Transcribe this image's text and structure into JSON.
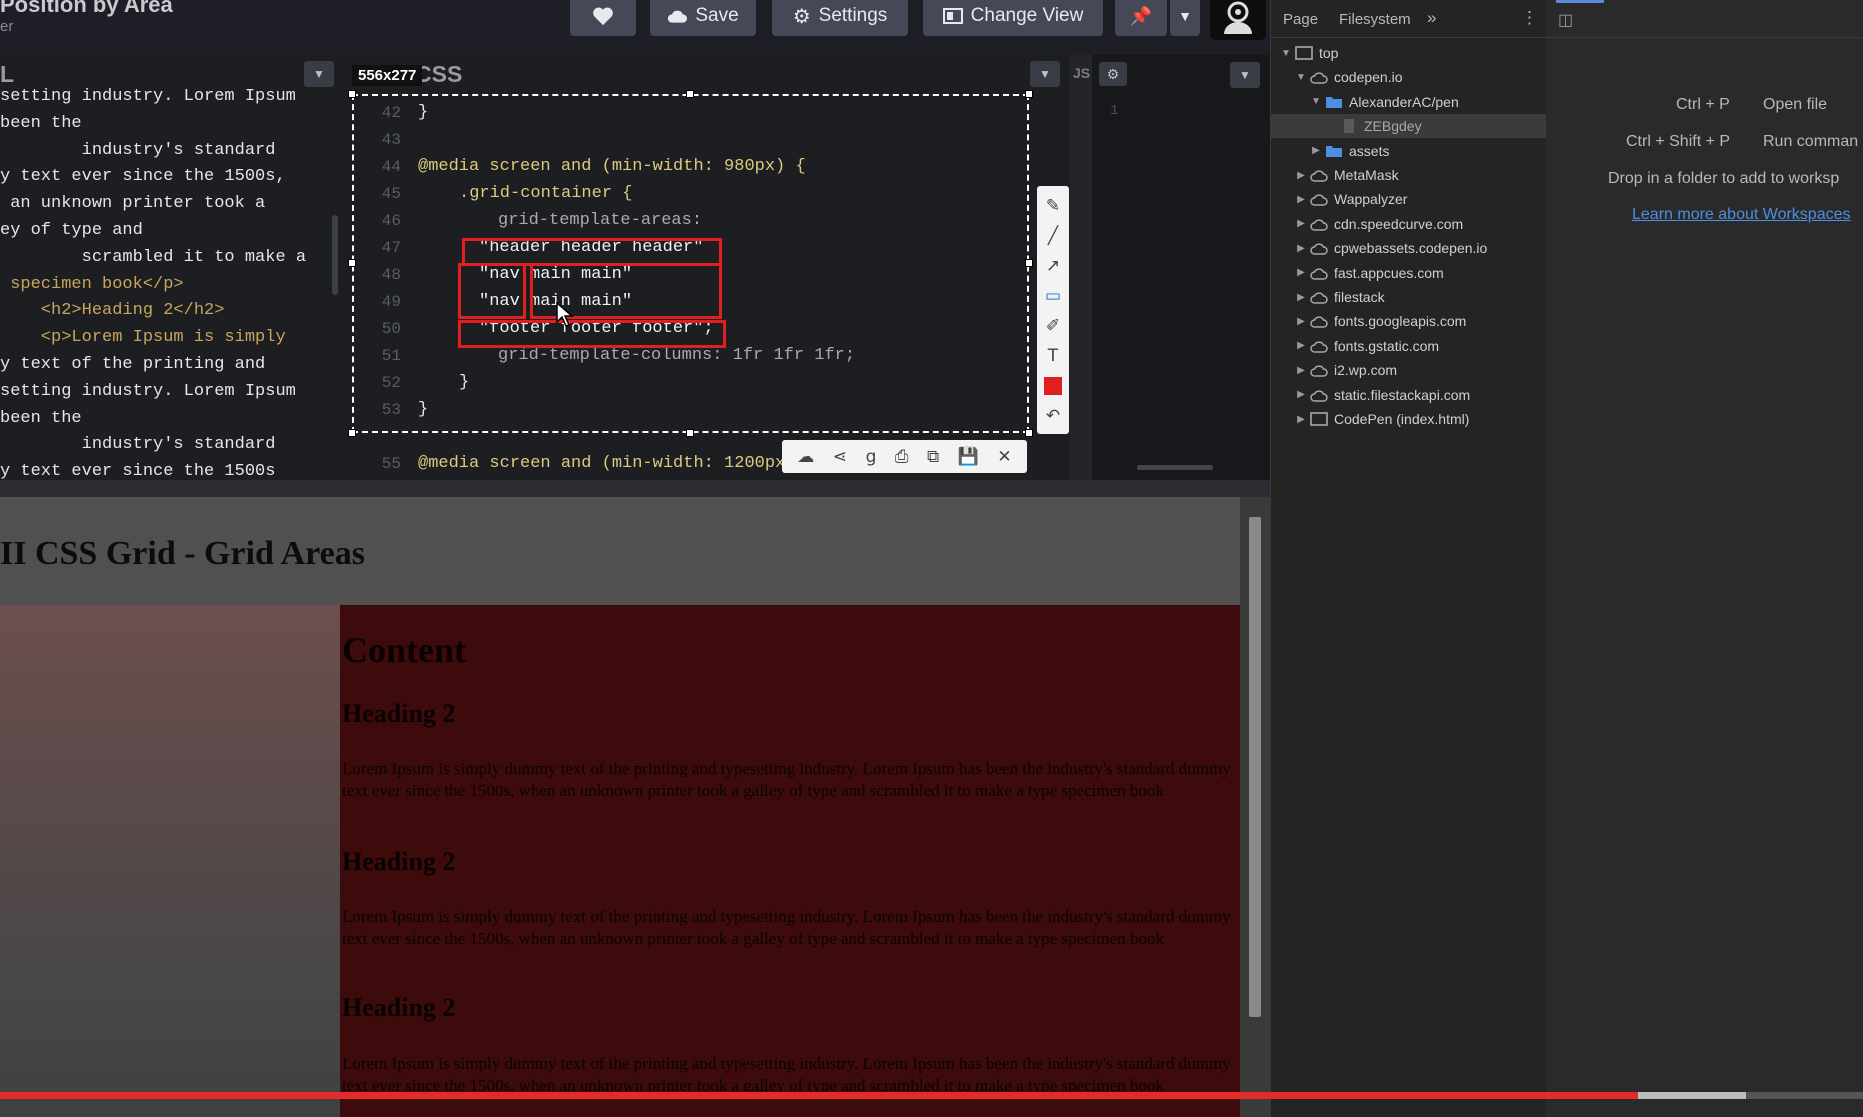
{
  "toolbar": {
    "pen_title": "Position by Area",
    "pen_subtitle": "er",
    "save_label": "Save",
    "settings_label": "Settings",
    "change_view_label": "Change View"
  },
  "html_editor": {
    "title": "L",
    "lines": [
      "setting industry. Lorem Ipsum",
      "been the",
      "        industry's standard",
      "y text ever since the 1500s,",
      " an unknown printer took a",
      "ey of type and",
      "        scrambled it to make a",
      " specimen book</p>",
      "    <h2>Heading 2</h2>",
      "    <p>Lorem Ipsum is simply",
      "y text of the printing and",
      "setting industry. Lorem Ipsum",
      "been the",
      "        industry's standard",
      "y text ever since the 1500s"
    ]
  },
  "css_editor": {
    "title": "CSS",
    "line_numbers": [
      "42",
      "43",
      "44",
      "45",
      "46",
      "47",
      "48",
      "49",
      "50",
      "51",
      "52",
      "53",
      "55"
    ],
    "media_query": "@media screen and (min-width: 980px) {",
    "selector": ".grid-container {",
    "areas_prop": "grid-template-areas:",
    "row1": "\"header header header\"",
    "row2": "\"nav main main\"",
    "row3": "\"nav main main\"",
    "row4": "\"footer footer footer\";",
    "columns_prop": "grid-template-columns: 1fr 1fr 1fr;",
    "close_inner": "}",
    "close_outer": "}",
    "close_prev": "}",
    "next_media": "@media screen and (min-width: 1200px"
  },
  "js_editor": {
    "title": "JS",
    "line1": "1"
  },
  "screenshot_tool": {
    "dimensions": "556x277"
  },
  "devtools": {
    "tabs": [
      "Page",
      "Filesystem"
    ],
    "tree": [
      {
        "label": "top",
        "level": 0
      },
      {
        "label": "codepen.io",
        "level": 1
      },
      {
        "label": "AlexanderAC/pen",
        "level": 2
      },
      {
        "label": "ZEBgdey",
        "level": 3
      },
      {
        "label": "assets",
        "level": 2
      },
      {
        "label": "MetaMask",
        "level": 1
      },
      {
        "label": "Wappalyzer",
        "level": 1
      },
      {
        "label": "cdn.speedcurve.com",
        "level": 1
      },
      {
        "label": "cpwebassets.codepen.io",
        "level": 1
      },
      {
        "label": "fast.appcues.com",
        "level": 1
      },
      {
        "label": "filestack",
        "level": 1
      },
      {
        "label": "fonts.googleapis.com",
        "level": 1
      },
      {
        "label": "fonts.gstatic.com",
        "level": 1
      },
      {
        "label": "i2.wp.com",
        "level": 1
      },
      {
        "label": "static.filestackapi.com",
        "level": 1
      },
      {
        "label": "CodePen (index.html)",
        "level": 1
      }
    ],
    "shortcuts": {
      "open_file_keys": "Ctrl + P",
      "open_file_label": "Open file",
      "run_command_keys": "Ctrl + Shift + P",
      "run_command_label": "Run comman",
      "drop_hint": "Drop in a folder to add to worksp",
      "learn_more": "Learn more about Workspaces"
    }
  },
  "preview": {
    "page_title": "II CSS Grid - Grid Areas",
    "content_heading": "Content",
    "heading2": "Heading 2",
    "paragraph": "Lorem Ipsum is simply dummy text of the printing and typesetting industry. Lorem Ipsum has been the industry's standard dummy text ever since the 1500s, when an unknown printer took a galley of type and scrambled it to make a type specimen book"
  },
  "video_progress": {
    "played_fraction": 0.879,
    "buffered_end_fraction": 0.937
  },
  "colors": {
    "editor_bg": "#1d1e22",
    "annotation_red": "#e02020",
    "preview_main": "#3d0b0b",
    "progress_red": "#e52a2a"
  }
}
